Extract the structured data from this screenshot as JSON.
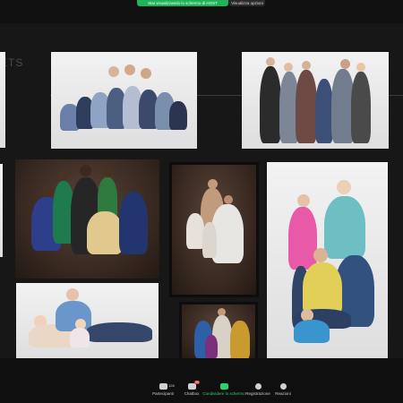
{
  "topbar": {
    "share_status": "Stai visualizzando lo schermo di HOST",
    "options_label": "Visualizza opzioni"
  },
  "stage": {
    "ghost_text": "ETS"
  },
  "photos": [
    {
      "id": "family-large-white"
    },
    {
      "id": "family-five-white"
    },
    {
      "id": "family-brown-backdrop"
    },
    {
      "id": "couple-with-children-dark"
    },
    {
      "id": "family-standing-white"
    },
    {
      "id": "couple-with-baby-white"
    },
    {
      "id": "family-small-dark"
    }
  ],
  "toolbar": {
    "items": [
      {
        "label": "Partecipanti",
        "count": "128",
        "icon": "participants-icon"
      },
      {
        "label": "Chatbox",
        "badge": "99",
        "icon": "chat-icon"
      },
      {
        "label": "Condividere lo schermo",
        "icon": "share-screen-icon",
        "color": "#2fcf6a"
      },
      {
        "label": "Registrazione",
        "icon": "record-icon"
      },
      {
        "label": "Reazioni",
        "icon": "reactions-icon"
      }
    ]
  }
}
